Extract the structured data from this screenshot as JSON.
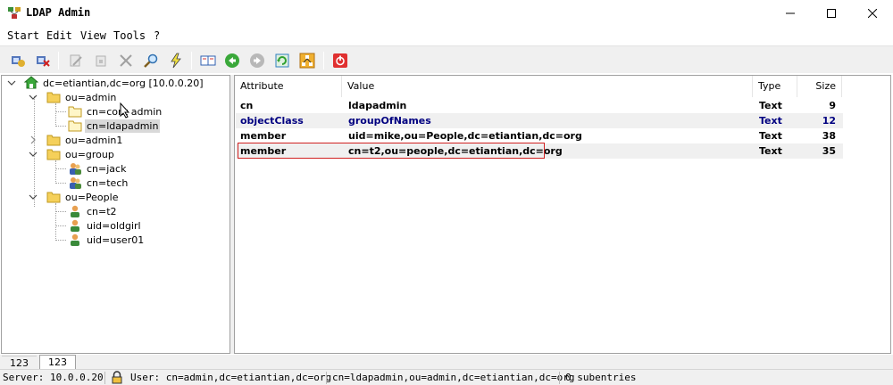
{
  "window": {
    "title": "LDAP Admin",
    "minimize_glyph": "—",
    "maximize_glyph": "☐",
    "close_glyph": "✕"
  },
  "menu": [
    "Start",
    "Edit",
    "View",
    "Tools",
    "?"
  ],
  "toolbar": {
    "buttons": [
      "connect-icon",
      "disconnect-icon",
      "edit-icon",
      "properties-icon",
      "delete-icon",
      "search-icon",
      "lightning-icon",
      "book-icon",
      "back-icon",
      "forward-icon",
      "refresh-icon",
      "tree-icon",
      "exit-icon"
    ]
  },
  "tree": {
    "root": "dc=etiantian,dc=org [10.0.0.20]",
    "nodes": [
      {
        "label": "ou=admin"
      },
      {
        "label": "cn=cont admin"
      },
      {
        "label": "cn=ldapadmin"
      },
      {
        "label": "ou=admin1"
      },
      {
        "label": "ou=group"
      },
      {
        "label": "cn=jack"
      },
      {
        "label": "cn=tech"
      },
      {
        "label": "ou=People"
      },
      {
        "label": "cn=t2"
      },
      {
        "label": "uid=oldgirl"
      },
      {
        "label": "uid=user01"
      }
    ]
  },
  "list": {
    "columns": [
      "Attribute",
      "Value",
      "Type",
      "Size"
    ],
    "rows": [
      {
        "attribute": "cn",
        "value": "ldapadmin",
        "type": "Text",
        "size": "9"
      },
      {
        "attribute": "objectClass",
        "value": "groupOfNames",
        "type": "Text",
        "size": "12"
      },
      {
        "attribute": "member",
        "value": "uid=mike,ou=People,dc=etiantian,dc=org",
        "type": "Text",
        "size": "38"
      },
      {
        "attribute": "member",
        "value": "cn=t2,ou=people,dc=etiantian,dc=org",
        "type": "Text",
        "size": "35"
      }
    ]
  },
  "tabs": [
    "123",
    "123"
  ],
  "status": {
    "server": "Server: 10.0.0.20",
    "user": "User: cn=admin,dc=etiantian,dc=org",
    "dn": "cn=ldapadmin,ou=admin,dc=etiantian,dc=org",
    "subentries": "0 subentries"
  },
  "colors": {
    "folder": "#f5d05a",
    "accent_blue": "#000080",
    "highlight_red": "#d02020"
  }
}
